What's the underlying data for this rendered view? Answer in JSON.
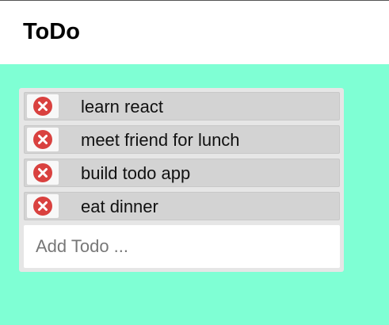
{
  "app": {
    "title": "ToDo"
  },
  "todos": [
    {
      "text": "learn react"
    },
    {
      "text": "meet friend for lunch"
    },
    {
      "text": "build todo app"
    },
    {
      "text": "eat dinner"
    }
  ],
  "add_input": {
    "value": "",
    "placeholder": "Add Todo ..."
  },
  "icons": {
    "delete": "close-circle-icon"
  },
  "colors": {
    "page_background": "#7fffd4",
    "header_background": "#ffffff",
    "card_background": "#e6e6e6",
    "item_background": "#d3d3d3",
    "delete_icon": "#d9413f"
  }
}
